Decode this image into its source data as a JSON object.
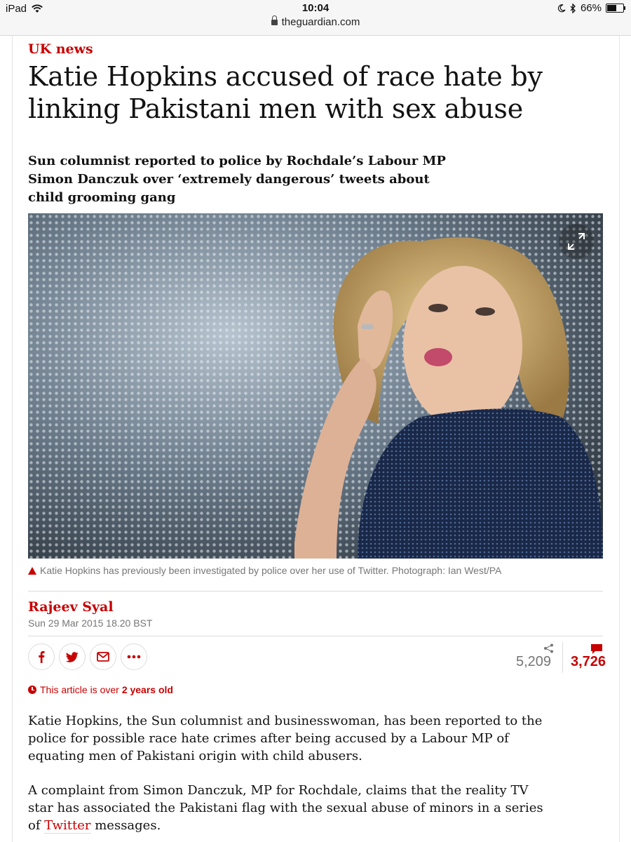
{
  "status_bar": {
    "device": "iPad",
    "time": "10:04",
    "url": "theguardian.com",
    "battery": "66%",
    "battery_level": 0.66
  },
  "article": {
    "section": "UK news",
    "headline": "Katie Hopkins accused of race hate by linking Pakistani men with sex abuse",
    "standfirst": "Sun columnist reported to police by Rochdale’s Labour MP Simon Danczuk over ‘extremely dangerous’ tweets about child grooming gang",
    "caption": "Katie Hopkins has previously been investigated by police over her use of Twitter. Photograph: Ian West/PA",
    "byline": "Rajeev Syal",
    "date": "Sun 29 Mar 2015 18.20 BST",
    "shares": "5,209",
    "comments": "3,726",
    "age_notice_prefix": "This article is over",
    "age_notice_value": "2 years old",
    "para1": "Katie Hopkins, the Sun columnist and businesswoman, has been reported to the police for possible race hate crimes after being accused by a Labour MP of equating men of Pakistani origin with child abusers.",
    "para2_text": "A complaint from Simon Danczuk, MP for Rochdale, claims that the reality TV star has associated the Pakistani flag with the sexual abuse of minors in a series of",
    "para2_link": "Twitter",
    "para2_end": "messages."
  },
  "share_buttons": [
    "facebook-icon",
    "twitter-icon",
    "email-icon",
    "more-icon"
  ],
  "colors": {
    "accent": "#c70000",
    "text": "#121212",
    "muted": "#767676"
  }
}
